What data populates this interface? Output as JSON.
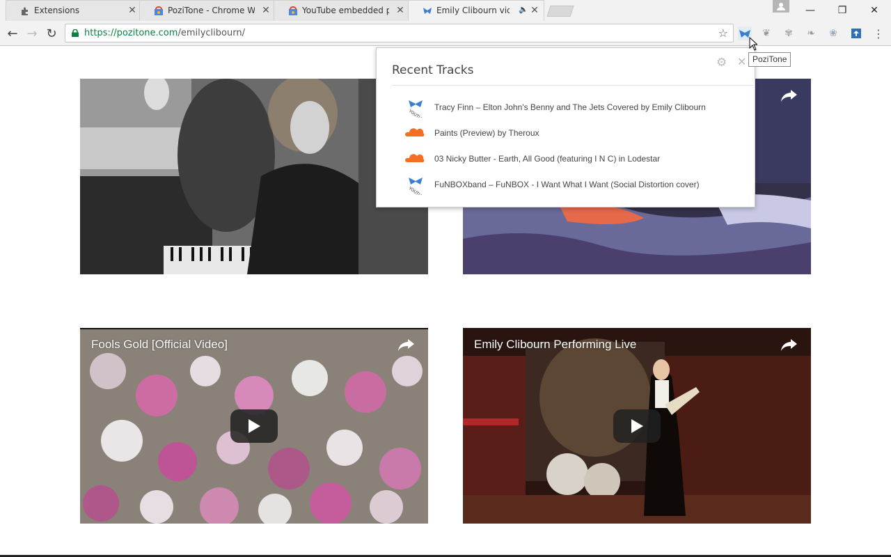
{
  "browser": {
    "tabs": [
      {
        "title": "Extensions",
        "icon": "puzzle-icon"
      },
      {
        "title": "PoziTone - Chrome Web",
        "icon": "chrome-webstore-icon"
      },
      {
        "title": "YouTube embedded play",
        "icon": "chrome-webstore-icon"
      },
      {
        "title": "Emily Clibourn video",
        "icon": "pozitone-icon",
        "audio": true
      }
    ],
    "active_tab": 3,
    "url_domain": "https://pozitone.com",
    "url_path": "/emilyclibourn/",
    "tooltip": "PoziTone"
  },
  "popup": {
    "title": "Recent Tracks",
    "tracks": [
      {
        "label": "Tracy Finn – Elton John's Benny and The Jets Covered by Emily Clibourn",
        "source": "youtube-embed-icon"
      },
      {
        "label": "Paints (Preview) by Theroux",
        "source": "soundcloud-icon"
      },
      {
        "label": "03 Nicky Butter - Earth, All Good (featuring I N C) in Lodestar",
        "source": "soundcloud-icon"
      },
      {
        "label": "FuNBOXband – FuNBOX - I Want What I Want (Social Distortion cover)",
        "source": "youtube-embed-icon"
      }
    ]
  },
  "videos": [
    {
      "title": ""
    },
    {
      "title": ""
    },
    {
      "title": "Fools Gold [Official Video]"
    },
    {
      "title": "Emily Clibourn Performing Live"
    }
  ],
  "colors": {
    "accent_blue": "#3b7fd0",
    "soundcloud_orange": "#f26f23",
    "secure_green": "#0b8043"
  }
}
